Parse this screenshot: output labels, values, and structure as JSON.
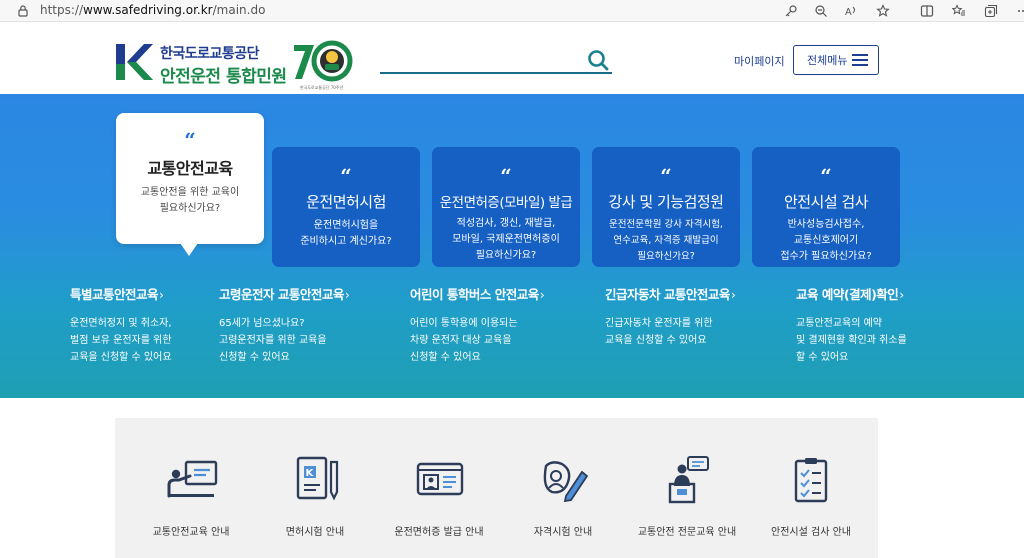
{
  "browser": {
    "url_prefix": "https://",
    "url_host": "www.safedriving.or.kr",
    "url_path": "/main.do",
    "icons": [
      "key-icon",
      "zoom-icon",
      "read-aloud-icon",
      "favorite-icon",
      "split-screen-icon",
      "favorites-list-icon",
      "collections-icon",
      "more-icon"
    ]
  },
  "header": {
    "logo_line1": "한국도로교통공단",
    "logo_line2": "안전운전 통합민원",
    "anniversary_number": "70",
    "anniversary_caption": "한국도로교통공단 70주년",
    "search_placeholder": "",
    "mypage_label": "마이페이지",
    "menu_label": "전체메뉴"
  },
  "hero": {
    "cards": [
      {
        "title": "교통안전교육",
        "desc1": "교통안전을 위한 교육이",
        "desc2": "필요하신가요?",
        "desc3": "",
        "active": true
      },
      {
        "title": "운전면허시험",
        "desc1": "운전면허시험을",
        "desc2": "준비하시고 계신가요?",
        "desc3": ""
      },
      {
        "title": "운전면허증(모바일) 발급",
        "desc1": "적성검사, 갱신, 재발급,",
        "desc2": "모바일, 국제운전면허증이",
        "desc3": "필요하신가요?"
      },
      {
        "title": "강사 및 기능검정원",
        "desc1": "운전전문학원 강사 자격시험,",
        "desc2": "연수교육, 자격증 재발급이",
        "desc3": "필요하신가요?"
      },
      {
        "title": "안전시설 검사",
        "desc1": "반사성능검사접수,",
        "desc2": "교통신호제어기",
        "desc3": "접수가 필요하신가요?"
      }
    ],
    "links": [
      {
        "title": "특별교통안전교육",
        "d1": "운전면허정지 및 취소자,",
        "d2": "벌점 보유 운전자를 위한",
        "d3": "교육을 신청할 수 있어요"
      },
      {
        "title": "고령운전자 교통안전교육",
        "d1": "65세가 넘으셨나요?",
        "d2": "고령운전자를 위한 교육을",
        "d3": "신청할 수 있어요"
      },
      {
        "title": "어린이 통학버스 안전교육",
        "d1": "어린이 통학용에 이용되는",
        "d2": "차량 운전자 대상 교육을",
        "d3": "신청할 수 있어요"
      },
      {
        "title": "긴급자동차 교통안전교육",
        "d1": "긴급자동차 운전자를 위한",
        "d2": "교육을 신청할 수 있어요",
        "d3": ""
      },
      {
        "title": "교육 예약(결제)확인",
        "d1": "교통안전교육의 예약",
        "d2": "및 결제현황 확인과 취소를",
        "d3": "할 수 있어요"
      }
    ],
    "chevron": "〉"
  },
  "guide": {
    "items": [
      {
        "label": "교통안전교육 안내",
        "icon": "lecture-icon"
      },
      {
        "label": "면허시험 안내",
        "icon": "license-book-icon"
      },
      {
        "label": "운전면허증 발급 안내",
        "icon": "id-card-icon"
      },
      {
        "label": "자격시험 안내",
        "icon": "exam-pen-icon"
      },
      {
        "label": "교통안전 전문교육 안내",
        "icon": "speaker-podium-icon"
      },
      {
        "label": "안전시설 검사 안내",
        "icon": "checklist-icon"
      }
    ]
  },
  "colors": {
    "navy": "#1d3f91",
    "brand_green": "#1c8a4b",
    "card_blue": "#1660c4",
    "hero_top": "#2b87e3",
    "hero_bottom": "#1f9fb3"
  }
}
